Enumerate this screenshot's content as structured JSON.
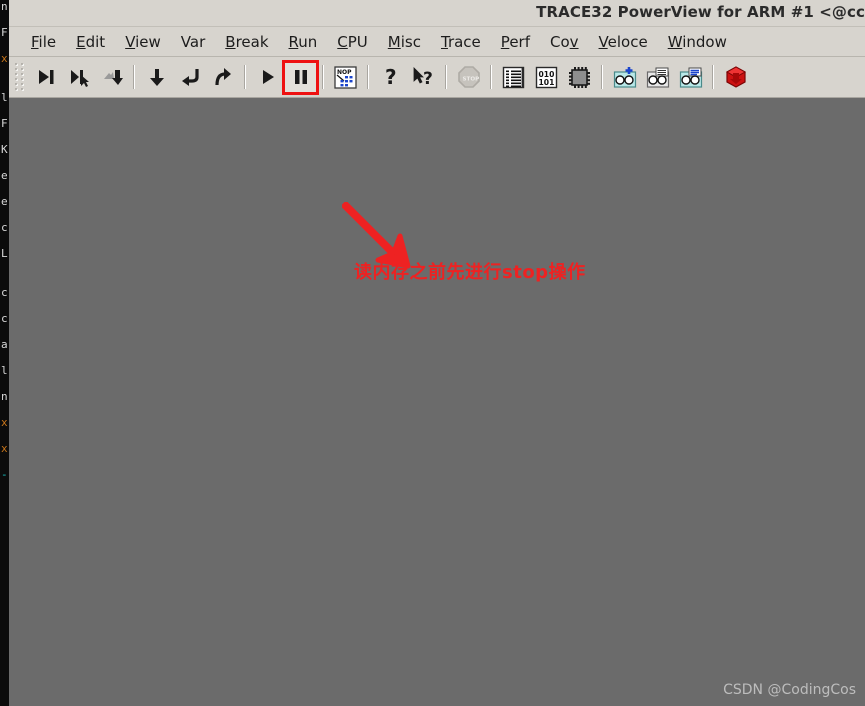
{
  "background_terminal": {
    "name": "background-terminal-window",
    "lines": [
      {
        "text": "n|",
        "color": "white"
      },
      {
        "text": "F",
        "color": "white"
      },
      {
        "text": "x",
        "color": "amber"
      },
      {
        "text": "l|",
        "color": "white"
      },
      {
        "text": "F",
        "color": "white"
      },
      {
        "text": "K",
        "color": "white"
      },
      {
        "text": "e",
        "color": "white"
      },
      {
        "text": "e",
        "color": "white"
      },
      {
        "text": "c",
        "color": "white"
      },
      {
        "text": "L|",
        "color": "white"
      },
      {
        "text": "c",
        "color": "white"
      },
      {
        "text": "c",
        "color": "white"
      },
      {
        "text": "a",
        "color": "white"
      },
      {
        "text": "l:",
        "color": "white"
      },
      {
        "text": "n|",
        "color": "white"
      },
      {
        "text": "x",
        "color": "amber"
      },
      {
        "text": "x",
        "color": "amber"
      },
      {
        "text": "-",
        "color": "cyan"
      }
    ]
  },
  "title_bar": {
    "title": "TRACE32 PowerView for ARM #1 <@cc"
  },
  "menu_bar": {
    "items": [
      {
        "name": "menu-file",
        "pre": "",
        "accel": "F",
        "post": "ile"
      },
      {
        "name": "menu-edit",
        "pre": "",
        "accel": "E",
        "post": "dit"
      },
      {
        "name": "menu-view",
        "pre": "",
        "accel": "V",
        "post": "iew"
      },
      {
        "name": "menu-var",
        "pre": "Var",
        "accel": "",
        "post": ""
      },
      {
        "name": "menu-break",
        "pre": "",
        "accel": "B",
        "post": "reak"
      },
      {
        "name": "menu-run",
        "pre": "",
        "accel": "R",
        "post": "un"
      },
      {
        "name": "menu-cpu",
        "pre": "",
        "accel": "C",
        "post": "PU"
      },
      {
        "name": "menu-misc",
        "pre": "",
        "accel": "M",
        "post": "isc"
      },
      {
        "name": "menu-trace",
        "pre": "",
        "accel": "T",
        "post": "race"
      },
      {
        "name": "menu-perf",
        "pre": "",
        "accel": "P",
        "post": "erf"
      },
      {
        "name": "menu-cov",
        "pre": "Co",
        "accel": "v",
        "post": ""
      },
      {
        "name": "menu-veloce",
        "pre": "",
        "accel": "V",
        "post": "eloce"
      },
      {
        "name": "menu-window",
        "pre": "",
        "accel": "W",
        "post": "indow"
      }
    ]
  },
  "toolbar": {
    "grip_name": "toolbar-grip",
    "buttons": [
      {
        "name": "step-icon",
        "icon": "step",
        "enabled": true,
        "highlighted": false
      },
      {
        "name": "step-over-cursor-icon",
        "icon": "step-cursor",
        "enabled": true,
        "highlighted": false
      },
      {
        "name": "step-back-icon",
        "icon": "step-back",
        "enabled": true,
        "highlighted": false
      },
      {
        "name": "separator",
        "icon": "sep",
        "enabled": true,
        "highlighted": false
      },
      {
        "name": "step-down-icon",
        "icon": "down-arrow",
        "enabled": true,
        "highlighted": false
      },
      {
        "name": "step-into-icon",
        "icon": "step-into",
        "enabled": true,
        "highlighted": false
      },
      {
        "name": "step-out-icon",
        "icon": "step-out",
        "enabled": true,
        "highlighted": false
      },
      {
        "name": "separator",
        "icon": "sep",
        "enabled": true,
        "highlighted": false
      },
      {
        "name": "go-run-icon",
        "icon": "play",
        "enabled": true,
        "highlighted": false
      },
      {
        "name": "break-stop-icon",
        "icon": "pause",
        "enabled": true,
        "highlighted": true
      },
      {
        "name": "separator",
        "icon": "sep",
        "enabled": true,
        "highlighted": false
      },
      {
        "name": "nop-list-icon",
        "icon": "nop",
        "enabled": true,
        "highlighted": false
      },
      {
        "name": "separator",
        "icon": "sep",
        "enabled": true,
        "highlighted": false
      },
      {
        "name": "help-icon",
        "icon": "question",
        "enabled": true,
        "highlighted": false
      },
      {
        "name": "context-help-icon",
        "icon": "arrow-question",
        "enabled": true,
        "highlighted": false
      },
      {
        "name": "separator",
        "icon": "sep",
        "enabled": true,
        "highlighted": false
      },
      {
        "name": "stop-sign-icon",
        "icon": "stopsign",
        "enabled": false,
        "highlighted": false
      },
      {
        "name": "separator",
        "icon": "sep",
        "enabled": true,
        "highlighted": false
      },
      {
        "name": "list-source-icon",
        "icon": "listing",
        "enabled": true,
        "highlighted": false
      },
      {
        "name": "memory-dump-icon",
        "icon": "binary",
        "enabled": true,
        "highlighted": false
      },
      {
        "name": "peripheral-chip-icon",
        "icon": "chip",
        "enabled": true,
        "highlighted": false
      },
      {
        "name": "separator",
        "icon": "sep",
        "enabled": true,
        "highlighted": false
      },
      {
        "name": "var-watch-add-icon",
        "icon": "glasses-plus",
        "enabled": true,
        "highlighted": false
      },
      {
        "name": "var-local-icon",
        "icon": "glasses-list",
        "enabled": true,
        "highlighted": false
      },
      {
        "name": "var-view-icon",
        "icon": "glasses-blue",
        "enabled": true,
        "highlighted": false
      },
      {
        "name": "separator",
        "icon": "sep",
        "enabled": true,
        "highlighted": false
      },
      {
        "name": "red-cube-icon",
        "icon": "redcube",
        "enabled": true,
        "highlighted": false
      }
    ],
    "binary_icon_text_top": "010",
    "binary_icon_text_bottom": "101",
    "nop_icon_text": "NOP",
    "stopsign_icon_text": "STOP"
  },
  "annotation": {
    "arrow_name": "annotation-arrow",
    "arrow_color": "#ee2222",
    "text": "读内存之前先进行stop操作",
    "text_color": "#ee2222"
  },
  "watermark": {
    "text": "CSDN @CodingCos"
  },
  "colors": {
    "chrome": "#d7d4ce",
    "client_background": "#6b6b6b",
    "highlight_red": "#ee1111",
    "terminal_background": "#0b0b0b"
  }
}
